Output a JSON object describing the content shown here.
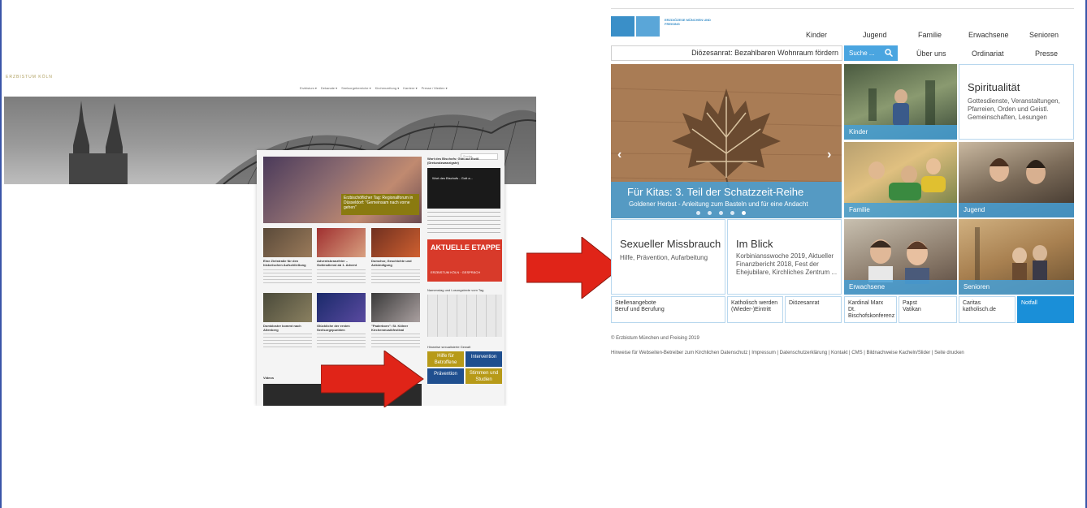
{
  "left_site": {
    "logo": "ERZBISTUM KÖLN",
    "nav": [
      "Erzbistum ▾",
      "Dekanate ▾",
      "Seelsorgebereiche ▾",
      "Kirchenzeitung ▾",
      "Karriere ▾",
      "Presse / Medien ▾"
    ],
    "search_placeholder": "Suche",
    "feature_caption": "Erzbischöflicher Tag: Regionalforum in Düsseldorf: \"Gemeinsam nach vorne gehen\"",
    "side_title": "Wort des Bischofs: Gott auf Ewiß (Dreiundzwanzigste)",
    "video_caption": "Wort des Bischofs - Gott a...",
    "red_banner": "AKTUELLE ETAPPE",
    "red_banner_sub": "ERZBISTUM KÖLN · GESPRÄCH",
    "calendar_title": "Namenstag und Losungstexte vom Tag",
    "hilfe_title": "Hinweise sexualisierte Gewalt",
    "tiles": [
      {
        "label": "Hilfe für Betroffene",
        "color": "#b79a18"
      },
      {
        "label": "Intervention",
        "color": "#1f4f8f"
      },
      {
        "label": "Prävention",
        "color": "#1f4f8f"
      },
      {
        "label": "Stimmen und Studien",
        "color": "#b79a18"
      }
    ],
    "grid_titles": [
      "Eine Zielstraße für den historischen Aufschließung",
      "Adventskranzfeier – Gottesdienst ab 1. Advent",
      "Domchor, Geschichte und Ankündigung",
      "Domkloster kommt nach Altenberg",
      "Glückliche der ersten Seelsorgepunkten",
      "\"Paderborn\": St. Kölner Kirchenmusikfestival"
    ],
    "videos_label": "Videos"
  },
  "right_site": {
    "logo_text": "ERZDIÖZESE MÜNCHEN UND FREISING",
    "nav_top": [
      "Kinder",
      "Jugend",
      "Familie",
      "Erwachsene",
      "Senioren"
    ],
    "ticker": "Diözesanrat: Bezahlbaren Wohnraum fördern",
    "search_placeholder": "Suche ...",
    "nav_second": [
      "Über uns",
      "Ordinariat",
      "Presse"
    ],
    "hero": {
      "title": "Für Kitas: 3. Teil der Schatzzeit-Reihe",
      "subtitle": "Goldener Herbst - Anleitung zum Basteln und für eine Andacht",
      "dots": 5,
      "active_dot": 5
    },
    "photo_tiles": {
      "kinder": "Kinder",
      "familie": "Familie",
      "jugend": "Jugend",
      "erwachsene": "Erwachsene",
      "senioren": "Senioren"
    },
    "spiritualitaet": {
      "title": "Spiritualität",
      "body": "Gottesdienste, Veranstaltungen, Pfarreien, Orden und Geistl. Gemeinschaften, Lesungen"
    },
    "missbrauch": {
      "title": "Sexueller Missbrauch",
      "body": "Hilfe, Prävention, Aufarbeitung"
    },
    "im_blick": {
      "title": "Im Blick",
      "body": "Korbiniansswoche 2019, Aktueller Finanzbericht 2018, Fest der Ehejubilare, Kirchliches Zentrum ..."
    },
    "footer_links": [
      {
        "line1": "Stellenangebote",
        "line2": "Beruf und Berufung"
      },
      {
        "line1": "Katholisch werden",
        "line2": "(Wieder-)Eintritt"
      },
      {
        "line1": "Diözesanrat",
        "line2": ""
      },
      {
        "line1": "Kardinal Marx",
        "line2": "Dt. Bischofskonferenz"
      },
      {
        "line1": "Papst",
        "line2": "Vatikan"
      },
      {
        "line1": "Caritas",
        "line2": "katholisch.de"
      },
      {
        "line1": "Notfall",
        "line2": ""
      }
    ],
    "copyright": "© Erzbistum München und Freising 2019",
    "legal_links": "Hinweise für Webseiten-Betreiber zum Kirchlichen Datenschutz  |  Impressum  |  Datenschutzerklärung  |  Kontakt  |  CMS  |  Bildnachweise Kacheln/Slider  |  Seite drucken"
  },
  "colors": {
    "arrow": "#e02418",
    "blue_accent": "#4aa5e0",
    "notfall": "#1a8fd8"
  }
}
